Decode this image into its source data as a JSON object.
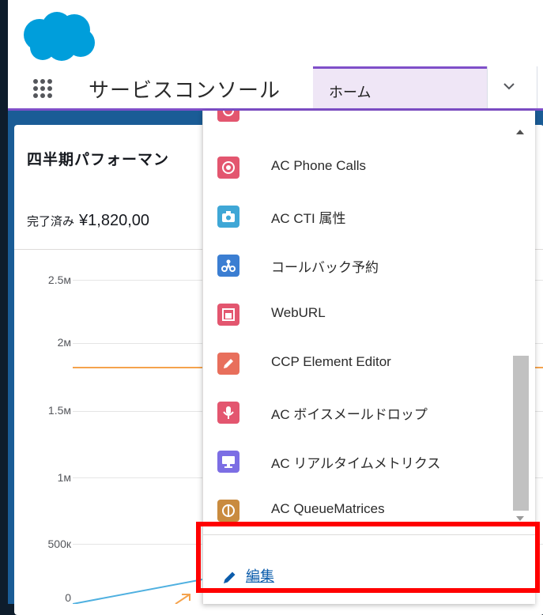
{
  "nav": {
    "app_name": "サービスコンソール",
    "active_tab": "ホーム"
  },
  "card": {
    "title": "四半期パフォーマン",
    "metric_label": "完了済み",
    "metric_value": "¥1,820,00",
    "y_ticks": [
      "2.5м",
      "2м",
      "1.5м",
      "1м",
      "500к",
      "0"
    ]
  },
  "dropdown": {
    "items": [
      {
        "label": "AC Phone Calls",
        "icon": "phone-calls-icon",
        "color": "#e3566f"
      },
      {
        "label": "AC CTI 属性",
        "icon": "camera-icon",
        "color": "#3fa7d6"
      },
      {
        "label": "コールバック予約",
        "icon": "callback-icon",
        "color": "#3b7ed2"
      },
      {
        "label": "WebURL",
        "icon": "web-url-icon",
        "color": "#e3566f"
      },
      {
        "label": "CCP Element Editor",
        "icon": "pencil-icon",
        "color": "#e86f5c"
      },
      {
        "label": "AC ボイスメールドロップ",
        "icon": "microphone-icon",
        "color": "#e3566f"
      },
      {
        "label": "AC リアルタイムメトリクス",
        "icon": "monitor-icon",
        "color": "#7c6ee4"
      },
      {
        "label": "AC QueueMatrices",
        "icon": "queue-icon",
        "color": "#c98b3f"
      }
    ],
    "edit_label": "編集"
  },
  "colors": {
    "nav_accent": "#7f4fc9",
    "highlight": "#ff0000",
    "link": "#0b5cab"
  }
}
